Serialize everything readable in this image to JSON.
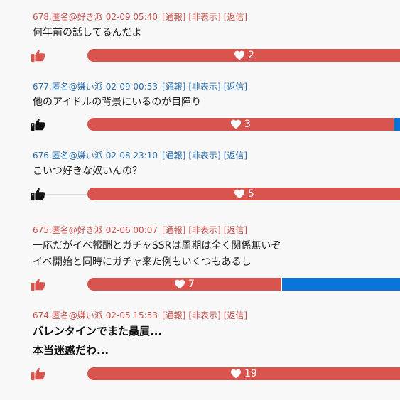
{
  "comments": [
    {
      "number": "678.",
      "author": "匿名@好き派",
      "date": "02-09 05:40",
      "actions": [
        "[通報]",
        "[非表示]",
        "[返信]"
      ],
      "lines": [
        "何年前の話してるんだよ"
      ],
      "likes": "2",
      "like_ratio": 1.0,
      "stance": "like",
      "bold": false
    },
    {
      "number": "677.",
      "author": "匿名@嫌い派",
      "date": "02-09 00:53",
      "actions": [
        "[通報]",
        "[非表示]",
        "[返信]"
      ],
      "lines": [
        "他のアイドルの背景にいるのが目障り"
      ],
      "likes": "3",
      "like_ratio": 0.98,
      "stance": "dislike",
      "bold": false
    },
    {
      "number": "676.",
      "author": "匿名@嫌い派",
      "date": "02-08 23:10",
      "actions": [
        "[通報]",
        "[非表示]",
        "[返信]"
      ],
      "lines": [
        "こいつ好きな奴いんの？"
      ],
      "likes": "5",
      "like_ratio": 1.0,
      "stance": "dislike",
      "bold": false
    },
    {
      "number": "675.",
      "author": "匿名@好き派",
      "date": "02-06 00:07",
      "actions": [
        "[通報]",
        "[非表示]",
        "[返信]"
      ],
      "lines": [
        "一応だがイベ報酬とガチャSSRは周期は全く関係無いぞ",
        "イベ開始と同時にガチャ来た例もいくつもあるし"
      ],
      "likes": "7",
      "like_ratio": 0.62,
      "stance": "like",
      "bold": false
    },
    {
      "number": "674.",
      "author": "匿名@嫌い派",
      "date": "02-05 15:53",
      "actions": [
        "[通報]",
        "[非表示]",
        "[返信]"
      ],
      "lines": [
        "バレンタインでまた贔屓...",
        "本当迷惑だわ..."
      ],
      "likes": "19",
      "like_ratio": 1.0,
      "stance": "like",
      "bold": true
    }
  ],
  "colors": {
    "like_red": "#d9534f",
    "dislike_blue": "#0a75d8",
    "author_like": "#c9504a",
    "author_dislike": "#2a6fb0"
  },
  "icons": {
    "vote": "thumbs-up-icon",
    "count": "heart-icon"
  }
}
